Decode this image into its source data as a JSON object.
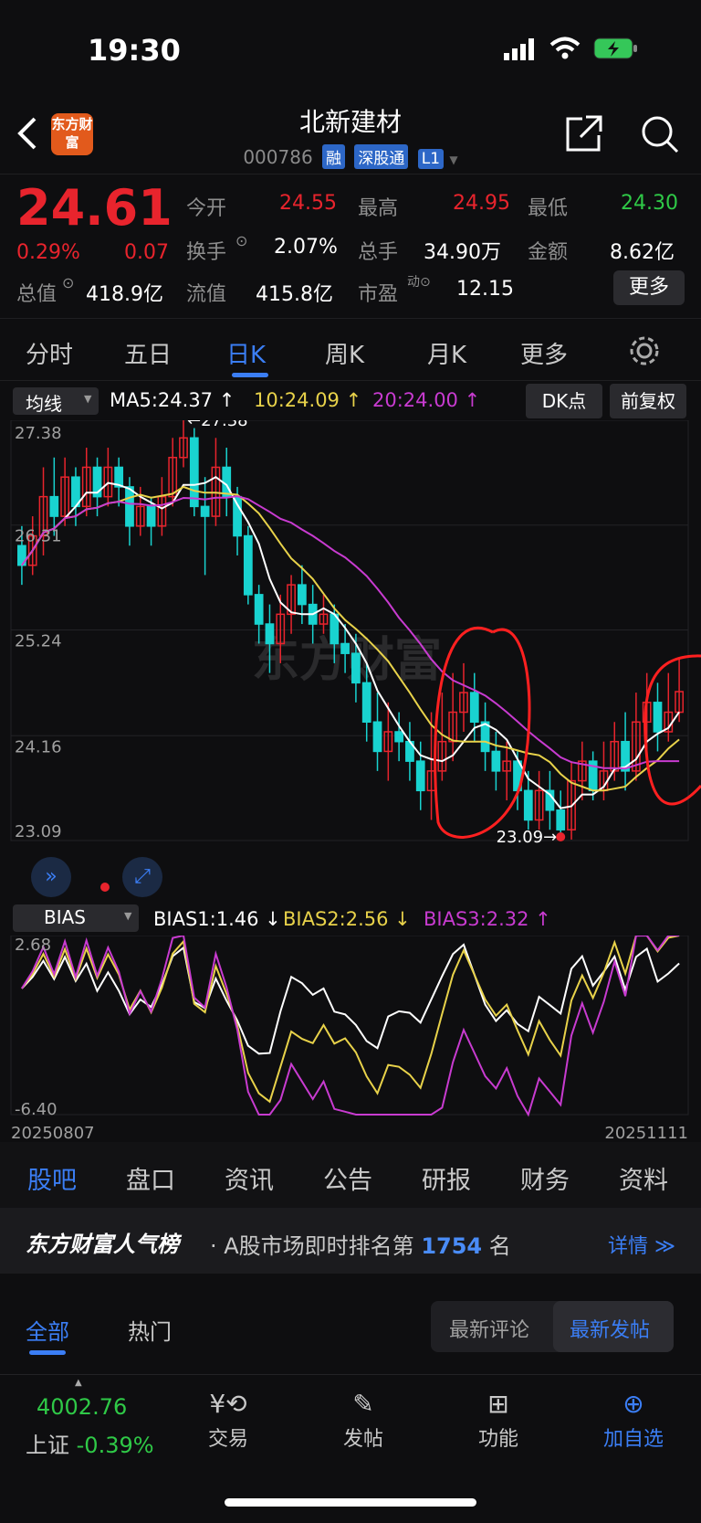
{
  "status": {
    "time": "19:30"
  },
  "header": {
    "logo_text": "东方财富",
    "title": "北新建材",
    "code": "000786",
    "tags": [
      "融",
      "深股通",
      "L1"
    ]
  },
  "quote": {
    "price": "24.61",
    "change_pct": "0.29%",
    "change": "0.07",
    "rows": [
      [
        {
          "label": "今开",
          "value": "24.55"
        },
        {
          "label": "最高",
          "value": "24.95"
        },
        {
          "label": "最低",
          "value": "24.30"
        }
      ],
      [
        {
          "label": "换手",
          "value": "2.07%"
        },
        {
          "label": "总手",
          "value": "34.90万"
        },
        {
          "label": "金额",
          "value": "8.62亿"
        }
      ],
      [
        {
          "label": "总值",
          "value": "418.9亿"
        },
        {
          "label": "流值",
          "value": "415.8亿"
        },
        {
          "label": "市盈",
          "value": "12.15"
        }
      ]
    ],
    "more_label": "更多"
  },
  "tabs": [
    "分时",
    "五日",
    "日K",
    "周K",
    "月K",
    "更多"
  ],
  "active_tab": "日K",
  "ma_bar": {
    "selector": "均线",
    "ma5": "MA5:24.37",
    "ma10": "10:24.09",
    "ma20": "20:24.00",
    "dk": "DK点",
    "adjust": "前复权"
  },
  "watermark": "东方财富",
  "bias_bar": {
    "selector": "BIAS",
    "bias1": "BIAS1:1.46",
    "bias2": "BIAS2:2.56",
    "bias3": "BIAS3:2.32"
  },
  "colors": {
    "up": "#e8242d",
    "down": "#19d3d0",
    "ma5": "#ffffff",
    "ma10": "#e8d24a",
    "ma20": "#c83bd0",
    "accent": "#3b7ef5"
  },
  "chart_data": {
    "type": "candlestick",
    "y_ticks": [
      "27.38",
      "26.31",
      "25.24",
      "24.16",
      "23.09"
    ],
    "ylim": [
      23.09,
      27.38
    ],
    "high_label": "27.38",
    "low_label": "23.09",
    "x_start": "20250807",
    "x_end": "20251111",
    "candles": [
      [
        26.1,
        25.9,
        26.3,
        25.7
      ],
      [
        25.9,
        26.2,
        26.4,
        25.8
      ],
      [
        26.2,
        26.6,
        26.9,
        26.0
      ],
      [
        26.6,
        26.4,
        27.0,
        26.2
      ],
      [
        26.4,
        26.8,
        27.0,
        26.3
      ],
      [
        26.8,
        26.5,
        26.9,
        26.3
      ],
      [
        26.5,
        26.9,
        27.1,
        26.4
      ],
      [
        26.9,
        26.6,
        27.0,
        26.4
      ],
      [
        26.6,
        26.9,
        27.1,
        26.5
      ],
      [
        26.9,
        26.7,
        27.0,
        26.5
      ],
      [
        26.7,
        26.3,
        26.8,
        26.1
      ],
      [
        26.3,
        26.5,
        26.7,
        26.2
      ],
      [
        26.5,
        26.3,
        26.6,
        26.1
      ],
      [
        26.3,
        26.6,
        26.8,
        26.2
      ],
      [
        26.6,
        27.0,
        27.2,
        26.5
      ],
      [
        27.0,
        27.2,
        27.38,
        26.9
      ],
      [
        27.2,
        26.5,
        27.3,
        26.4
      ],
      [
        26.5,
        26.4,
        26.8,
        25.8
      ],
      [
        26.4,
        26.9,
        27.2,
        26.3
      ],
      [
        26.9,
        26.6,
        27.1,
        26.4
      ],
      [
        26.6,
        26.2,
        26.7,
        26.0
      ],
      [
        26.2,
        25.6,
        26.3,
        25.5
      ],
      [
        25.6,
        25.3,
        25.7,
        25.1
      ],
      [
        25.3,
        25.1,
        25.5,
        24.8
      ],
      [
        25.1,
        25.4,
        25.6,
        24.9
      ],
      [
        25.4,
        25.7,
        25.8,
        25.2
      ],
      [
        25.7,
        25.5,
        25.9,
        25.3
      ],
      [
        25.5,
        25.3,
        25.7,
        25.1
      ],
      [
        25.3,
        25.4,
        25.6,
        25.2
      ],
      [
        25.4,
        25.1,
        25.5,
        24.9
      ],
      [
        25.1,
        25.0,
        25.3,
        24.8
      ],
      [
        25.0,
        24.7,
        25.2,
        24.5
      ],
      [
        24.7,
        24.3,
        24.9,
        24.1
      ],
      [
        24.3,
        24.0,
        24.6,
        23.8
      ],
      [
        24.0,
        24.2,
        24.5,
        23.7
      ],
      [
        24.2,
        24.1,
        24.4,
        23.9
      ],
      [
        24.1,
        23.9,
        24.3,
        23.7
      ],
      [
        23.9,
        23.6,
        24.1,
        23.4
      ],
      [
        23.6,
        23.8,
        24.4,
        23.3
      ],
      [
        23.8,
        24.1,
        24.6,
        23.7
      ],
      [
        24.1,
        24.4,
        24.8,
        23.9
      ],
      [
        24.4,
        24.6,
        24.9,
        24.2
      ],
      [
        24.6,
        24.3,
        24.8,
        24.1
      ],
      [
        24.3,
        24.0,
        24.5,
        23.8
      ],
      [
        24.0,
        23.8,
        24.2,
        23.6
      ],
      [
        23.8,
        23.9,
        24.1,
        23.5
      ],
      [
        23.9,
        23.6,
        24.0,
        23.4
      ],
      [
        23.6,
        23.3,
        23.8,
        23.2
      ],
      [
        23.3,
        23.6,
        23.8,
        23.2
      ],
      [
        23.6,
        23.4,
        23.8,
        23.2
      ],
      [
        23.4,
        23.2,
        23.6,
        23.09
      ],
      [
        23.2,
        23.7,
        23.9,
        23.1
      ],
      [
        23.7,
        23.9,
        24.1,
        23.5
      ],
      [
        23.9,
        23.6,
        24.0,
        23.5
      ],
      [
        23.6,
        23.8,
        24.1,
        23.5
      ],
      [
        23.8,
        24.1,
        24.3,
        23.7
      ],
      [
        24.1,
        23.8,
        24.4,
        23.6
      ],
      [
        23.8,
        24.3,
        24.6,
        23.7
      ],
      [
        24.3,
        24.5,
        24.8,
        24.0
      ],
      [
        24.5,
        24.2,
        24.7,
        24.0
      ],
      [
        24.2,
        24.4,
        24.8,
        24.1
      ],
      [
        24.4,
        24.61,
        24.95,
        24.3
      ]
    ],
    "bias_ticks": [
      "2.68",
      "-6.40"
    ],
    "bias_ylim": [
      -6.4,
      2.68
    ]
  },
  "bottom_tabs": [
    "股吧",
    "盘口",
    "资讯",
    "公告",
    "研报",
    "财务",
    "资料"
  ],
  "rank": {
    "brand": "东方财富人气榜",
    "text_prefix": "· A股市场即时排名第",
    "number": "1754",
    "suffix": "名",
    "link": "详情 ≫"
  },
  "filters": {
    "all": "全部",
    "hot": "热门",
    "latest_comment": "最新评论",
    "latest_post": "最新发帖"
  },
  "bottom_nav": {
    "index_value": "4002.76",
    "index_name": "上证",
    "index_change": "-0.39%",
    "items": [
      "交易",
      "发帖",
      "功能",
      "加自选"
    ]
  }
}
